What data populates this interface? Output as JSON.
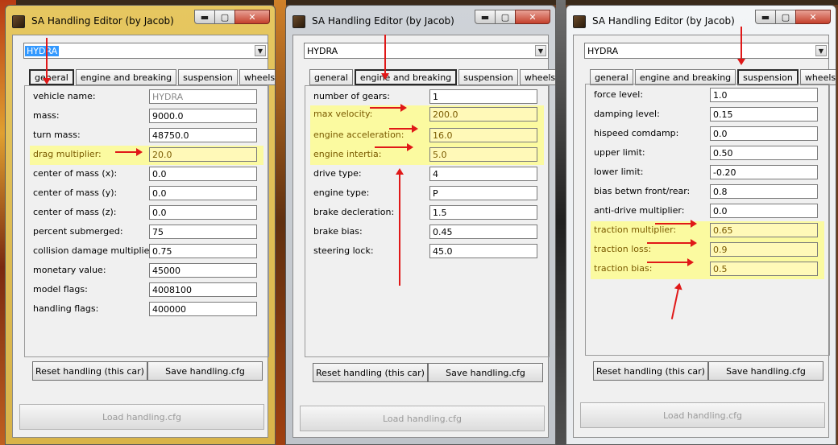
{
  "title": "SA Handling Editor (by Jacob)",
  "vehicle": "HYDRA",
  "tabs": [
    "general",
    "engine and breaking",
    "suspension",
    "wheels"
  ],
  "buttons": {
    "reset": "Reset handling (this car)",
    "save": "Save handling.cfg",
    "load": "Load handling.cfg"
  },
  "window_controls": {
    "minimize": "▬",
    "maximize": "▢",
    "close": "✕"
  },
  "general_fields": [
    {
      "label": "vehicle name:",
      "value": "HYDRA"
    },
    {
      "label": "mass:",
      "value": "9000.0"
    },
    {
      "label": "turn mass:",
      "value": "48750.0"
    },
    {
      "label": "drag multiplier:",
      "value": "20.0"
    },
    {
      "label": "center of mass (x):",
      "value": "0.0"
    },
    {
      "label": "center of mass (y):",
      "value": "0.0"
    },
    {
      "label": "center of mass (z):",
      "value": "0.0"
    },
    {
      "label": "percent submerged:",
      "value": "75"
    },
    {
      "label": "collision damage multiplier:",
      "value": "0.75"
    },
    {
      "label": "monetary value:",
      "value": "45000"
    },
    {
      "label": "model flags:",
      "value": "4008100"
    },
    {
      "label": "handling flags:",
      "value": "400000"
    }
  ],
  "engine_fields": [
    {
      "label": "number of gears:",
      "value": "1"
    },
    {
      "label": "max velocity:",
      "value": "200.0"
    },
    {
      "label": "engine acceleration:",
      "value": "16.0"
    },
    {
      "label": "engine intertia:",
      "value": "5.0"
    },
    {
      "label": "drive type:",
      "value": "4"
    },
    {
      "label": "engine type:",
      "value": "P"
    },
    {
      "label": "brake decleration:",
      "value": "1.5"
    },
    {
      "label": "brake bias:",
      "value": "0.45"
    },
    {
      "label": "steering lock:",
      "value": "45.0"
    }
  ],
  "suspension_fields": [
    {
      "label": "force level:",
      "value": "1.0"
    },
    {
      "label": "damping level:",
      "value": "0.15"
    },
    {
      "label": "hispeed comdamp:",
      "value": "0.0"
    },
    {
      "label": "upper limit:",
      "value": "0.50"
    },
    {
      "label": "lower limit:",
      "value": "-0.20"
    },
    {
      "label": "bias betwn front/rear:",
      "value": "0.8"
    },
    {
      "label": "anti-drive multiplier:",
      "value": "0.0"
    },
    {
      "label": "traction multiplier:",
      "value": "0.65"
    },
    {
      "label": "traction loss:",
      "value": "0.9"
    },
    {
      "label": "traction bias:",
      "value": "0.5"
    }
  ]
}
